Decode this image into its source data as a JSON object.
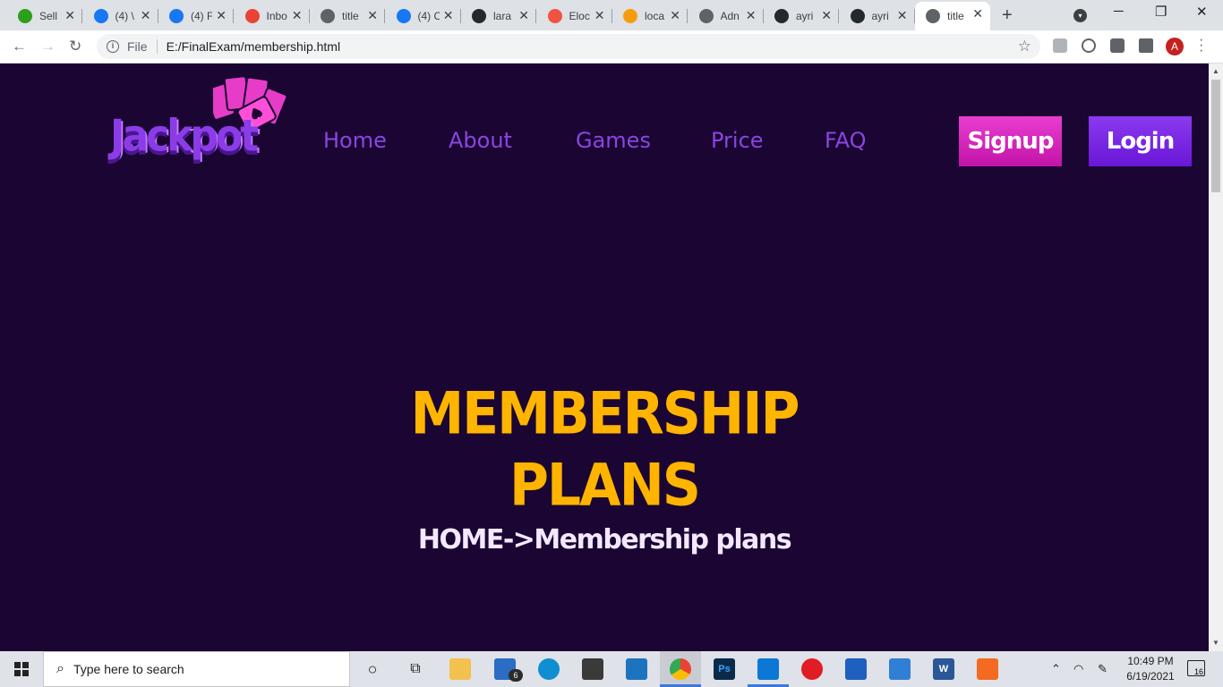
{
  "browser": {
    "tabs": [
      {
        "label": "Sell",
        "favicon_color": "#2ca01c"
      },
      {
        "label": "(4) \\",
        "favicon_color": "#1877f2"
      },
      {
        "label": "(4) F",
        "favicon_color": "#1877f2"
      },
      {
        "label": "Inbo",
        "favicon_color": "#ea4335"
      },
      {
        "label": "title",
        "favicon_color": "#5f6368"
      },
      {
        "label": "(4) C",
        "favicon_color": "#1877f2"
      },
      {
        "label": "lara",
        "favicon_color": "#24292e"
      },
      {
        "label": "Eloc",
        "favicon_color": "#f05340"
      },
      {
        "label": "loca",
        "favicon_color": "#f89c0e"
      },
      {
        "label": "Adn",
        "favicon_color": "#5f6368"
      },
      {
        "label": "ayri",
        "favicon_color": "#24292e"
      },
      {
        "label": "ayri",
        "favicon_color": "#24292e"
      },
      {
        "label": "title",
        "favicon_color": "#5f6368",
        "active": true
      }
    ],
    "address": {
      "scheme_label": "File",
      "url": "E:/FinalExam/membership.html"
    },
    "profile_initial": "A"
  },
  "site": {
    "logo_text": "Jackpot",
    "nav": [
      "Home",
      "About",
      "Games",
      "Price",
      "FAQ"
    ],
    "signup_label": "Signup",
    "login_label": "Login",
    "hero_line1": "MEMBERSHIP",
    "hero_line2": "PLANS",
    "breadcrumb": "HOME->Membership plans",
    "colors": {
      "background": "#1a0533",
      "nav_text": "#8b45e0",
      "hero_title": "#ffb400",
      "signup_bg": "#d12ab9",
      "login_bg": "#7a28e6"
    }
  },
  "taskbar": {
    "search_placeholder": "Type here to search",
    "mail_badge": "6",
    "time": "10:49 PM",
    "date": "6/19/2021",
    "notification_count": "16"
  }
}
